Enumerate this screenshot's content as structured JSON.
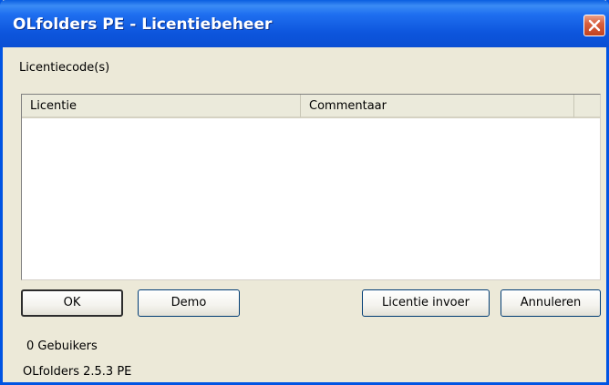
{
  "window": {
    "title": "OLfolders PE - Licentiebeheer",
    "close_icon": "close-icon"
  },
  "section_label": "Licentiecode(s)",
  "license_list": {
    "columns": [
      "Licentie",
      "Commentaar"
    ],
    "rows": []
  },
  "buttons": {
    "ok": "OK",
    "demo": "Demo",
    "license_input": "Licentie invoer",
    "cancel": "Annuleren"
  },
  "status": {
    "users": "0 Gebuikers",
    "version": "OLfolders 2.5.3 PE"
  },
  "colors": {
    "titlebar": "#0a5ee0",
    "window_bg": "#ece9d8",
    "close_button": "#d9603e"
  }
}
